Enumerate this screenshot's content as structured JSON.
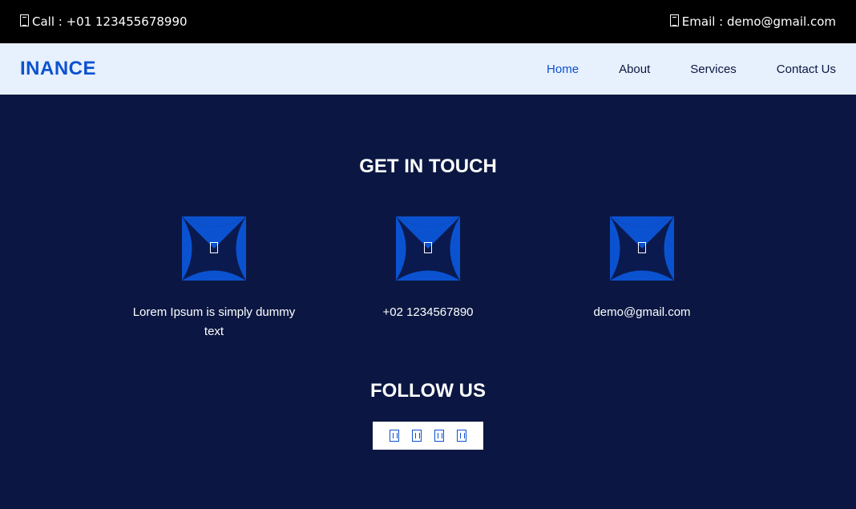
{
  "topbar": {
    "call_label": "Call : +01 123455678990",
    "call_icon": "phone-icon",
    "email_label": "Email : demo@gmail.com",
    "email_icon": "envelope-icon"
  },
  "navbar": {
    "logo": "INANCE",
    "links": [
      {
        "label": "Home",
        "active": true
      },
      {
        "label": "About",
        "active": false
      },
      {
        "label": "Services",
        "active": false
      },
      {
        "label": "Contact Us",
        "active": false
      }
    ]
  },
  "contact": {
    "title": "GET IN TOUCH",
    "items": [
      {
        "icon": "map-marker-icon",
        "text": "Lorem Ipsum is simply dummy text"
      },
      {
        "icon": "phone-icon",
        "text": "+02 1234567890"
      },
      {
        "icon": "envelope-icon",
        "text": "demo@gmail.com"
      }
    ]
  },
  "follow": {
    "title": "FOLLOW US",
    "icons": [
      "facebook-icon",
      "twitter-icon",
      "linkedin-icon",
      "instagram-icon"
    ]
  },
  "colors": {
    "background": "#0b1742",
    "accent": "#0b52d0",
    "topbar": "#000000",
    "navbar": "#e7f0fd"
  }
}
